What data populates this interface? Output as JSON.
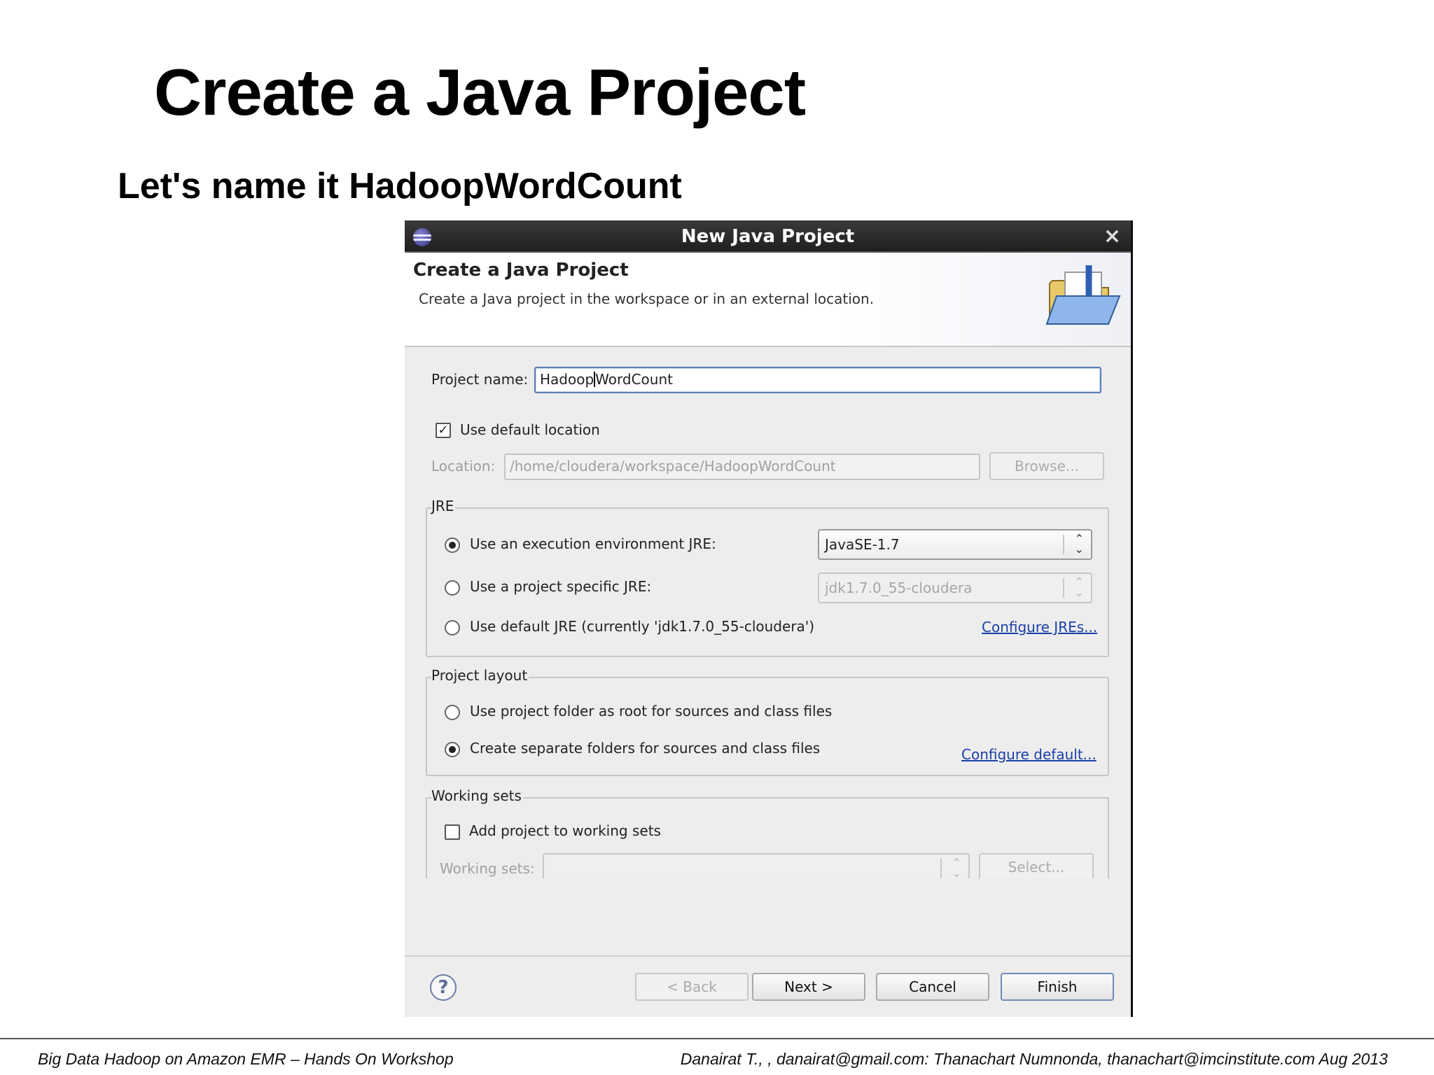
{
  "slide": {
    "title": "Create a Java Project",
    "subtitle": "Let's name it HadoopWordCount",
    "footer_left": "Big Data Hadoop on Amazon EMR – Hands On Workshop",
    "footer_right": "Danairat T., , danairat@gmail.com:  Thanachart Numnonda,  thanachart@imcinstitute.com   Aug 2013"
  },
  "dialog": {
    "window_title": "New Java Project",
    "close_glyph": "×",
    "banner_title": "Create a Java Project",
    "banner_description": "Create a Java project in the workspace or in an external location.",
    "project_name_label": "Project name:",
    "project_name_value_before_caret": "Hadoop",
    "project_name_value_after_caret": "WordCount",
    "use_default_location_label": "Use default location",
    "use_default_location_checked": true,
    "checkmark_glyph": "✓",
    "location_label": "Location:",
    "location_value": "/home/cloudera/workspace/HadoopWordCount",
    "browse_button": "Browse...",
    "jre": {
      "group_title": "JRE",
      "option_execution_env": "Use an execution environment JRE:",
      "execution_env_value": "JavaSE-1.7",
      "option_project_specific": "Use a project specific JRE:",
      "project_specific_value": "jdk1.7.0_55-cloudera",
      "option_default": "Use default JRE (currently 'jdk1.7.0_55-cloudera')",
      "configure_link": "Configure JREs...",
      "selected": "execution_env"
    },
    "layout": {
      "group_title": "Project layout",
      "option_root": "Use project folder as root for sources and class files",
      "option_separate": "Create separate folders for sources and class files",
      "configure_link": "Configure default...",
      "selected": "separate"
    },
    "working_sets": {
      "group_title": "Working sets",
      "add_label": "Add project to working sets",
      "add_checked": false,
      "sets_label": "Working sets:",
      "select_button": "Select..."
    },
    "buttons": {
      "help_glyph": "?",
      "back": "< Back",
      "next": "Next >",
      "cancel": "Cancel",
      "finish": "Finish"
    }
  },
  "icons": {
    "app": "eclipse-icon",
    "banner": "java-project-folder-icon",
    "help": "help-icon",
    "spinner": "up-down-arrows-icon"
  },
  "colors": {
    "titlebar": "#2b2b2b",
    "link": "#1a3fa8",
    "dialog_bg": "#ededed",
    "focus_border": "#5b7db5"
  }
}
